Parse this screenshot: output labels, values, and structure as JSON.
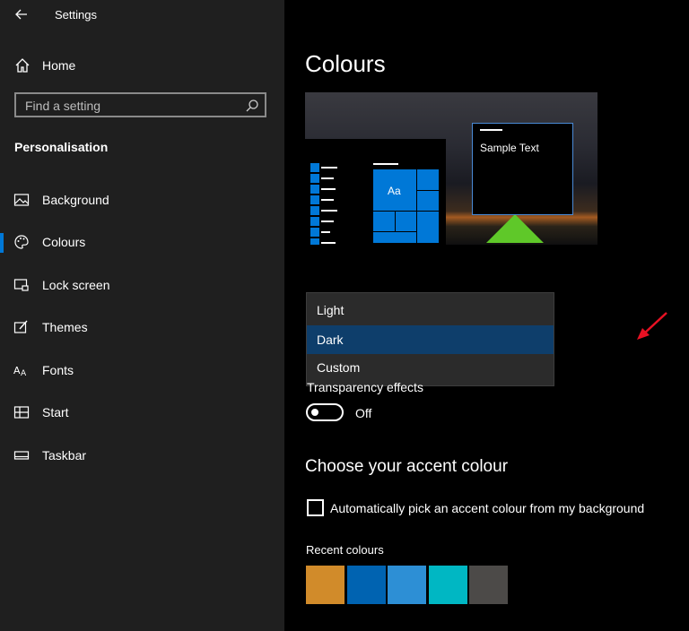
{
  "window": {
    "title": "Settings"
  },
  "sidebar": {
    "home_label": "Home",
    "search_placeholder": "Find a setting",
    "section_title": "Personalisation",
    "items": [
      {
        "label": "Background",
        "icon": "picture-icon"
      },
      {
        "label": "Colours",
        "icon": "palette-icon",
        "selected": true
      },
      {
        "label": "Lock screen",
        "icon": "lock-screen-icon"
      },
      {
        "label": "Themes",
        "icon": "themes-icon"
      },
      {
        "label": "Fonts",
        "icon": "fonts-icon"
      },
      {
        "label": "Start",
        "icon": "start-icon"
      },
      {
        "label": "Taskbar",
        "icon": "taskbar-icon"
      }
    ]
  },
  "main": {
    "title": "Colours",
    "preview": {
      "sample_text": "Sample Text",
      "tile_text": "Aa"
    },
    "colour_mode": {
      "options": [
        "Light",
        "Dark",
        "Custom"
      ],
      "selected": "Dark"
    },
    "transparency": {
      "label": "Transparency effects",
      "state": "Off"
    },
    "accent": {
      "title": "Choose your accent colour",
      "auto_pick_label": "Automatically pick an accent colour from my background",
      "auto_pick_checked": false,
      "recent_label": "Recent colours",
      "recent_colours": [
        "#d18b2a",
        "#0063b1",
        "#2d8fd5",
        "#00b7c3",
        "#4c4a48"
      ]
    }
  },
  "colors": {
    "accent": "#0078d7",
    "sidebar_bg": "#1f1f1f",
    "annotation_arrow": "#e81123"
  }
}
